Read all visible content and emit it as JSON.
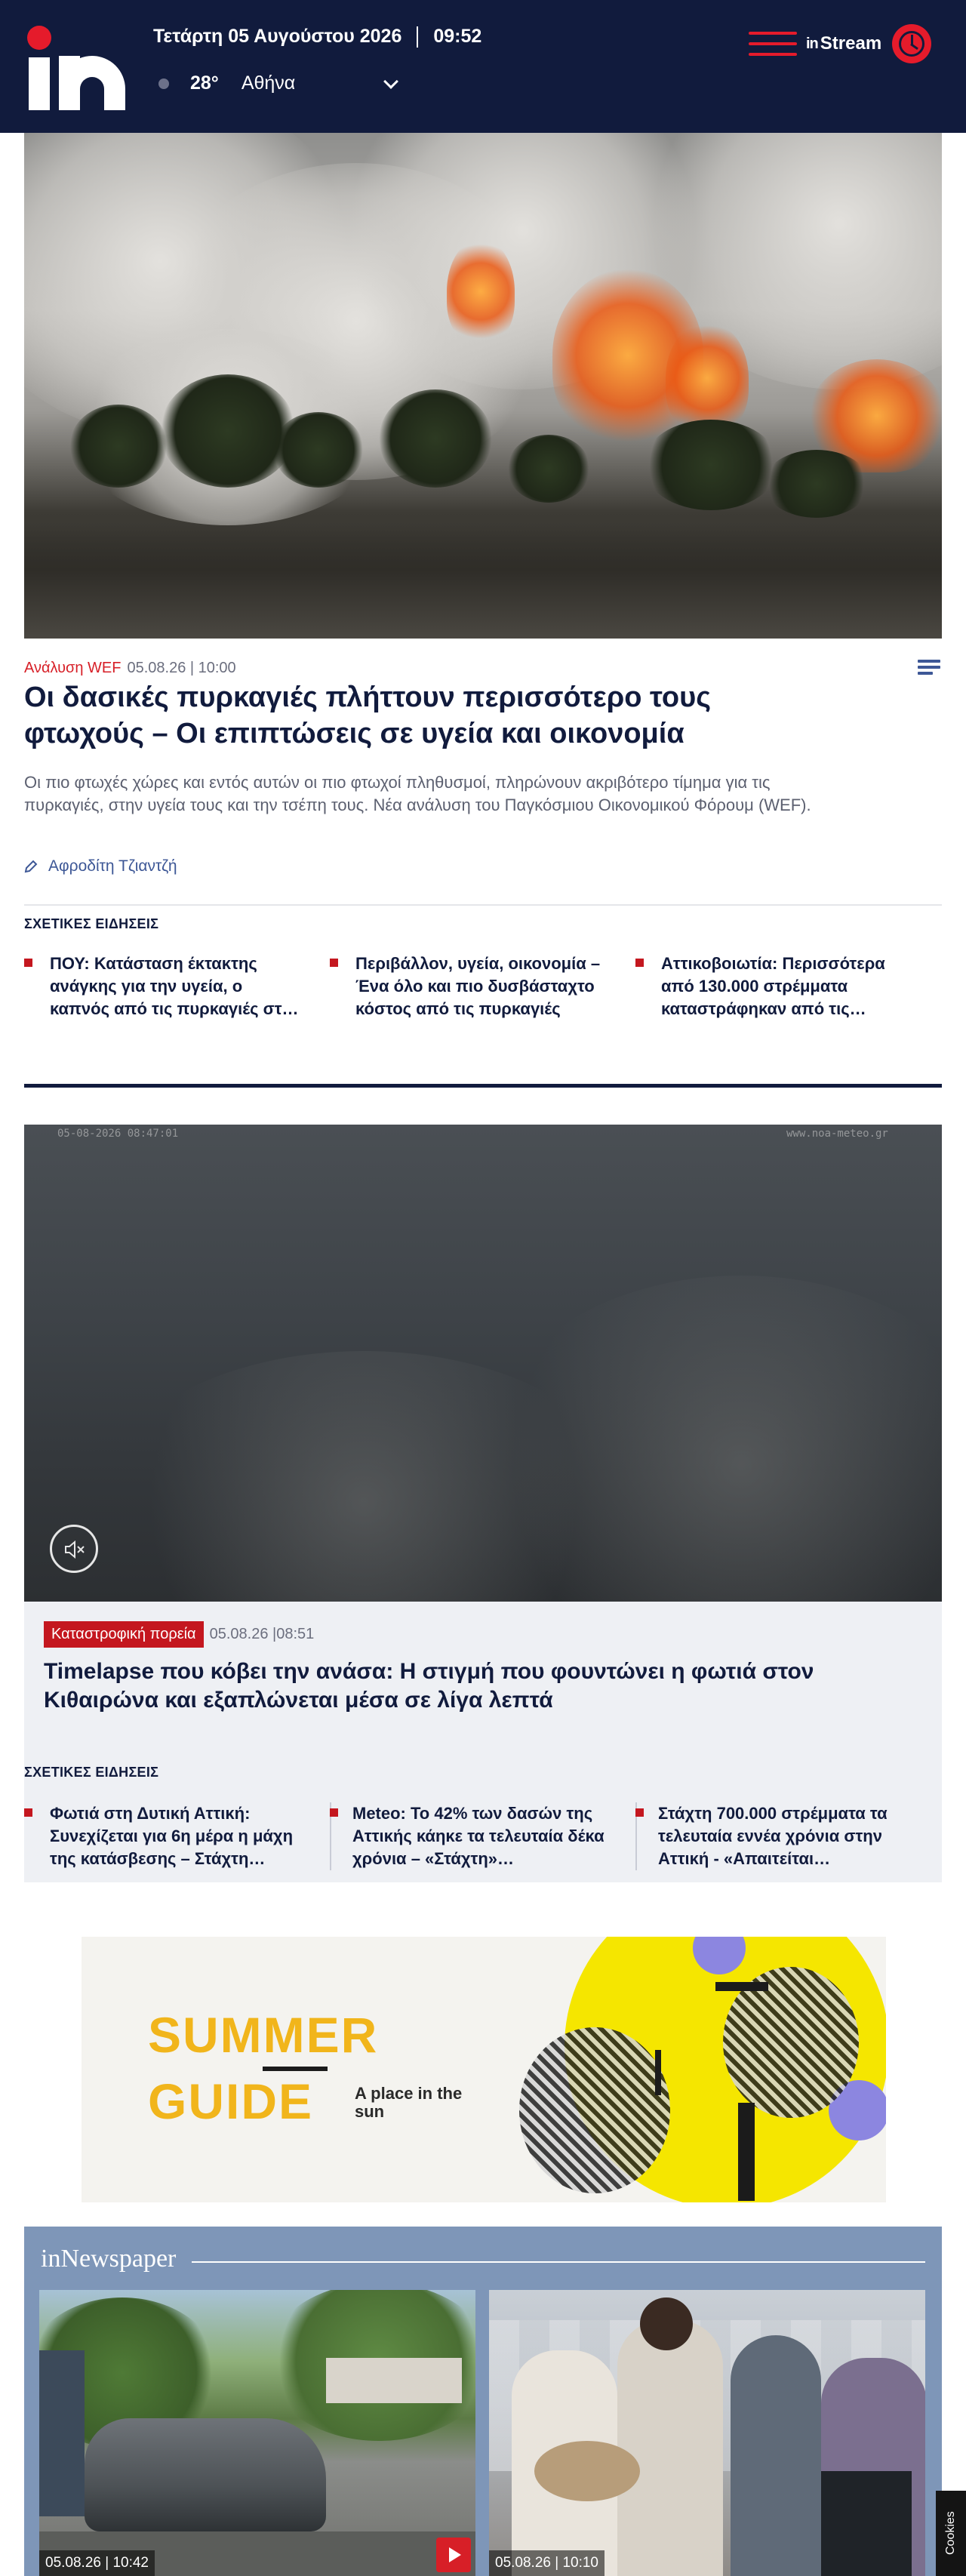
{
  "header": {
    "date": "Τετάρτη 05 Αυγούστου 2026",
    "time": "09:52",
    "temperature": "28°",
    "city": "Αθήνα",
    "instream_label": "Stream",
    "instream_mark": "in",
    "accent_color": "#e51b2b",
    "background_color": "#111b3d"
  },
  "hero": {
    "category": "Ανάλυση WEF",
    "datetime": "05.08.26 | 10:00",
    "title": "Οι δασικές πυρκαγιές πλήττουν περισσότερο τους φτωχούς – Οι επιπτώσεις σε  υγεία και  οικονομία",
    "lead": "Οι πιο φτωχές χώρες και εντός αυτών οι πιο φτωχοί πληθυσμοί, πληρώνουν ακριβότερο τίμημα για τις πυρκαγιές, στην υγεία τους και την τσέπη τους. Νέα ανάλυση του Παγκόσμιου Οικονομικού Φόρουμ (WEF).",
    "author": "Αφροδίτη Τζιαντζή",
    "related_label": "ΣΧΕΤΙΚΕΣ ΕΙΔΗΣΕΙΣ",
    "related": [
      "ΠΟΥ: Κατάσταση έκτακτης ανάγκης για την υγεία, ο καπνός από τις πυρκαγιές στ…",
      "Περιβάλλον, υγεία, οικονομία – Ένα όλο και πιο δυσβάσταχτο κόστος από τις πυρκαγιές",
      "Αττικοβοιωτία: Περισσότερα από 130.000 στρέμματα καταστράφηκαν από τις…"
    ]
  },
  "video_story": {
    "category": "Καταστροφική πορεία",
    "datetime": "05.08.26 |08:51",
    "title": "Timelapse που κόβει την ανάσα: Η στιγμή που φουντώνει η φωτιά στον Κιθαιρώνα και εξαπλώνεται μέσα σε λίγα λεπτά",
    "overlay_left": "05-08-2026 08:47:01",
    "overlay_right": "www.noa-meteo.gr",
    "related_label": "ΣΧΕΤΙΚΕΣ ΕΙΔΗΣΕΙΣ",
    "related": [
      "Φωτιά στη Δυτική Αττική: Συνεχίζεται για 6η μέρα η μάχη της κατάσβεσης – Στάχτη…",
      "Meteo: Το 42% των δασών της Αττικής κάηκε τα τελευταία δέκα χρόνια – «Στάχτη»…",
      "Στάχτη 700.000 στρέμματα τα τελευταία εννέα χρόνια στην Αττική - «Απαιτείται…"
    ]
  },
  "ad": {
    "headline_1": "SUMMER",
    "headline_2": "GUIDE",
    "tagline": "A place in the sun"
  },
  "newspaper": {
    "title": "inNewspaper",
    "cards": [
      {
        "datetime": "05.08.26 | 10:42"
      },
      {
        "datetime": "05.08.26 | 10:10"
      }
    ]
  },
  "cookies_label": "Cookies"
}
